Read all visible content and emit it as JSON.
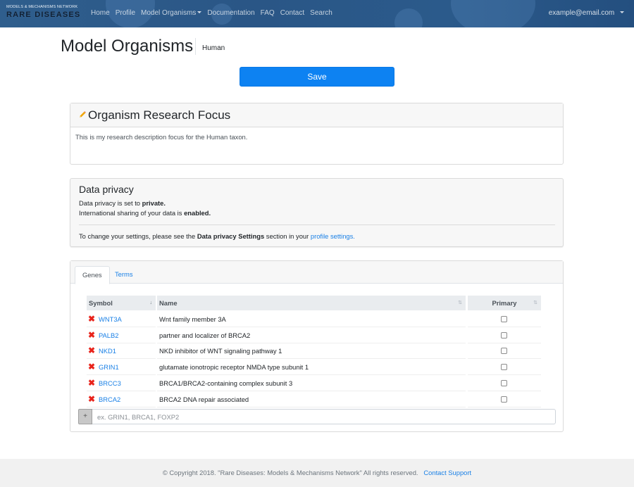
{
  "navbar": {
    "brand_top": "MODELS & MECHANISMS NETWORK",
    "brand_main": "RARE DISEASES",
    "links": [
      {
        "label": "Home"
      },
      {
        "label": "Profile"
      },
      {
        "label": "Model Organisms",
        "dropdown": true
      },
      {
        "label": "Documentation"
      },
      {
        "label": "FAQ"
      },
      {
        "label": "Contact"
      },
      {
        "label": "Search"
      }
    ],
    "user_email": "example@email.com"
  },
  "header": {
    "title": "Model Organisms",
    "taxon": "Human",
    "save_label": "Save"
  },
  "focus": {
    "title": "Organism Research Focus",
    "description": "This is my research description focus for the Human taxon."
  },
  "privacy": {
    "title": "Data privacy",
    "line1_prefix": "Data privacy is set to ",
    "line1_value": "private.",
    "line2_prefix": "International sharing of your data is ",
    "line2_value": "enabled.",
    "change_prefix": "To change your settings, please see the ",
    "change_section": "Data privacy Settings",
    "change_middle": " section in your ",
    "change_link": "profile settings."
  },
  "tabs": [
    {
      "label": "Genes",
      "active": true
    },
    {
      "label": "Terms",
      "active": false
    }
  ],
  "genes_table": {
    "columns": [
      "Symbol",
      "Name",
      "Primary"
    ],
    "rows": [
      {
        "symbol": "WNT3A",
        "name": "Wnt family member 3A",
        "primary": false
      },
      {
        "symbol": "PALB2",
        "name": "partner and localizer of BRCA2",
        "primary": false
      },
      {
        "symbol": "NKD1",
        "name": "NKD inhibitor of WNT signaling pathway 1",
        "primary": false
      },
      {
        "symbol": "GRIN1",
        "name": "glutamate ionotropic receptor NMDA type subunit 1",
        "primary": false
      },
      {
        "symbol": "BRCC3",
        "name": "BRCA1/BRCA2-containing complex subunit 3",
        "primary": false
      },
      {
        "symbol": "BRCA2",
        "name": "BRCA2 DNA repair associated",
        "primary": false
      }
    ],
    "add_button": "+",
    "add_placeholder": "ex. GRIN1, BRCA1, FOXP2"
  },
  "footer": {
    "copyright": "© Copyright 2018. \"Rare Diseases: Models & Mechanisms Network\" All rights reserved.",
    "support_link": "Contact Support"
  },
  "colors": {
    "navbar_bg": "#2b5a8b",
    "primary_button": "#0d82f2",
    "link": "#1a80e6",
    "delete": "#e8231b"
  }
}
